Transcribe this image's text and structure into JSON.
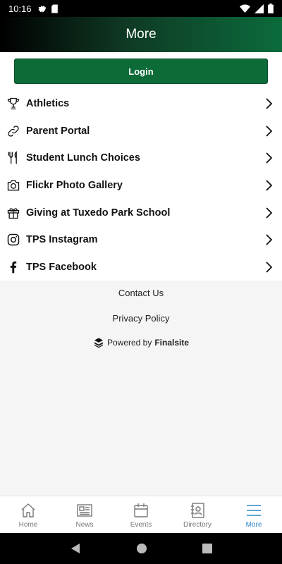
{
  "status": {
    "time": "10:16",
    "icons_left": [
      "gear-icon",
      "sd-card-icon"
    ],
    "icons_right": [
      "wifi-icon",
      "signal-icon",
      "battery-icon"
    ]
  },
  "header": {
    "title": "More"
  },
  "login": {
    "label": "Login",
    "color": "#0d6b38"
  },
  "menu": [
    {
      "label": "Athletics",
      "icon": "trophy-icon"
    },
    {
      "label": "Parent Portal",
      "icon": "link-icon"
    },
    {
      "label": "Student Lunch Choices",
      "icon": "fork-knife-icon"
    },
    {
      "label": "Flickr Photo Gallery",
      "icon": "camera-icon"
    },
    {
      "label": "Giving at Tuxedo Park School",
      "icon": "gift-icon"
    },
    {
      "label": "TPS Instagram",
      "icon": "instagram-icon"
    },
    {
      "label": "TPS Facebook",
      "icon": "facebook-icon"
    }
  ],
  "footer": {
    "contact": "Contact Us",
    "privacy": "Privacy Policy",
    "powered_prefix": "Powered by",
    "powered_brand": "Finalsite"
  },
  "tabs": [
    {
      "label": "Home",
      "icon": "home-icon",
      "active": false
    },
    {
      "label": "News",
      "icon": "newspaper-icon",
      "active": false
    },
    {
      "label": "Events",
      "icon": "calendar-icon",
      "active": false
    },
    {
      "label": "Directory",
      "icon": "directory-icon",
      "active": false
    },
    {
      "label": "More",
      "icon": "menu-icon",
      "active": true
    }
  ],
  "colors": {
    "accent": "#2f88c9",
    "header_end": "#0b6b3c"
  }
}
